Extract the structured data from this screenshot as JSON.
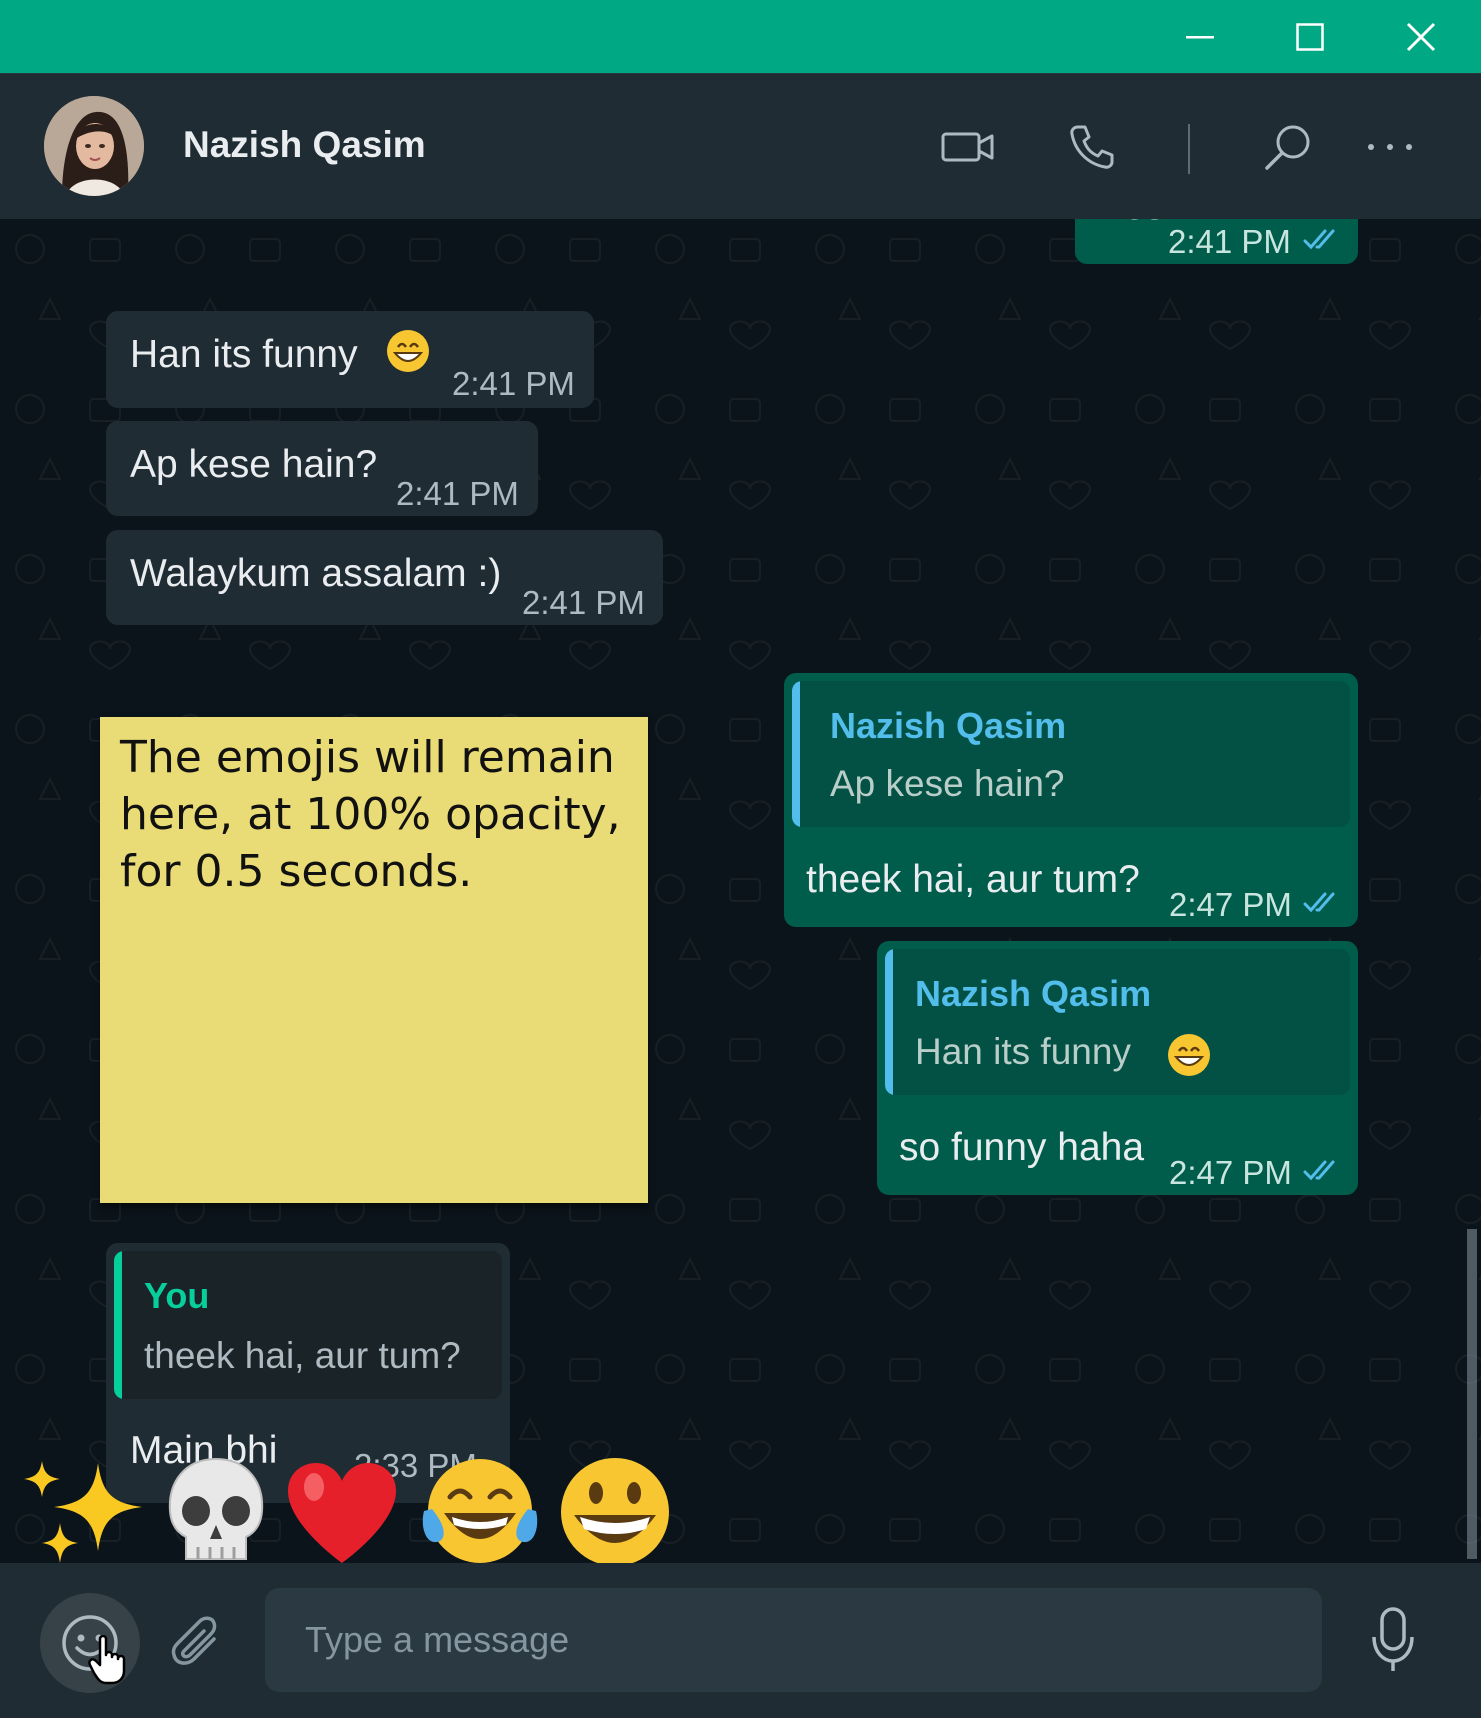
{
  "window": {
    "titlebar_color": "#00a884",
    "controls": [
      "minimize-icon",
      "maximize-icon",
      "close-icon"
    ]
  },
  "header": {
    "contact_name": "Nazish Qasim",
    "icons": [
      "video-call-icon",
      "voice-call-icon",
      "search-icon",
      "more-options-icon"
    ]
  },
  "messages": [
    {
      "direction": "out",
      "text": "Yes",
      "time": "2:41 PM",
      "status": "read"
    },
    {
      "direction": "in",
      "text": "Han its funny",
      "emoji": "grinning-face-with-smiling-eyes",
      "time": "2:41 PM"
    },
    {
      "direction": "in",
      "text": "Ap kese hain?",
      "time": "2:41 PM"
    },
    {
      "direction": "in",
      "text": "Walaykum assalam :)",
      "time": "2:41 PM"
    },
    {
      "direction": "out",
      "quote": {
        "name": "Nazish Qasim",
        "text": "Ap kese hain?"
      },
      "text": "theek hai, aur tum?",
      "time": "2:47 PM",
      "status": "read"
    },
    {
      "direction": "out",
      "quote": {
        "name": "Nazish Qasim",
        "text": "Han its funny",
        "emoji": "grinning-face-with-smiling-eyes"
      },
      "text": "so funny haha",
      "time": "2:47 PM",
      "status": "read"
    },
    {
      "direction": "in",
      "quote": {
        "name": "You",
        "text": "theek hai, aur tum?"
      },
      "text": "Main bhi",
      "time": "2:33 PM"
    }
  ],
  "sticky_note": {
    "text": "The emojis will remain here, at 100% opacity, for 0.5 seconds.",
    "color": "#e9dc76"
  },
  "emoji_bar": [
    "sparkles-emoji",
    "skull-emoji",
    "red-heart-emoji",
    "face-with-tears-of-joy-emoji",
    "grinning-face-emoji"
  ],
  "composer": {
    "placeholder": "Type a message"
  },
  "colors": {
    "incoming_bubble": "#202c33",
    "outgoing_bubble": "#005c4b",
    "quote_name_incoming": "#06cf9c",
    "quote_name_outgoing": "#53bdeb",
    "read_tick": "#53bdeb"
  }
}
